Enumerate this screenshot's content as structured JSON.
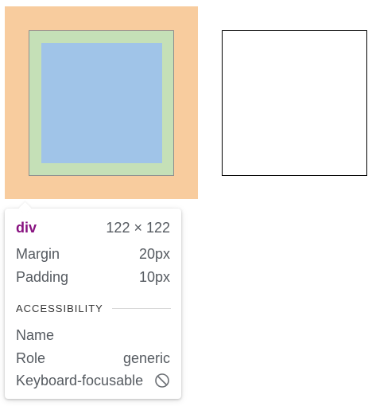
{
  "tooltip": {
    "tag": "div",
    "dimensions": "122 × 122",
    "margin_label": "Margin",
    "margin_value": "20px",
    "padding_label": "Padding",
    "padding_value": "10px",
    "accessibility_header": "ACCESSIBILITY",
    "name_label": "Name",
    "role_label": "Role",
    "role_value": "generic",
    "keyboard_label": "Keyboard-focusable",
    "keyboard_icon": "not-focusable-icon"
  },
  "colors": {
    "margin": "#f8cc9e",
    "border": "#c5e0b7",
    "content": "#a0c4e8",
    "tag_name": "#881280"
  }
}
